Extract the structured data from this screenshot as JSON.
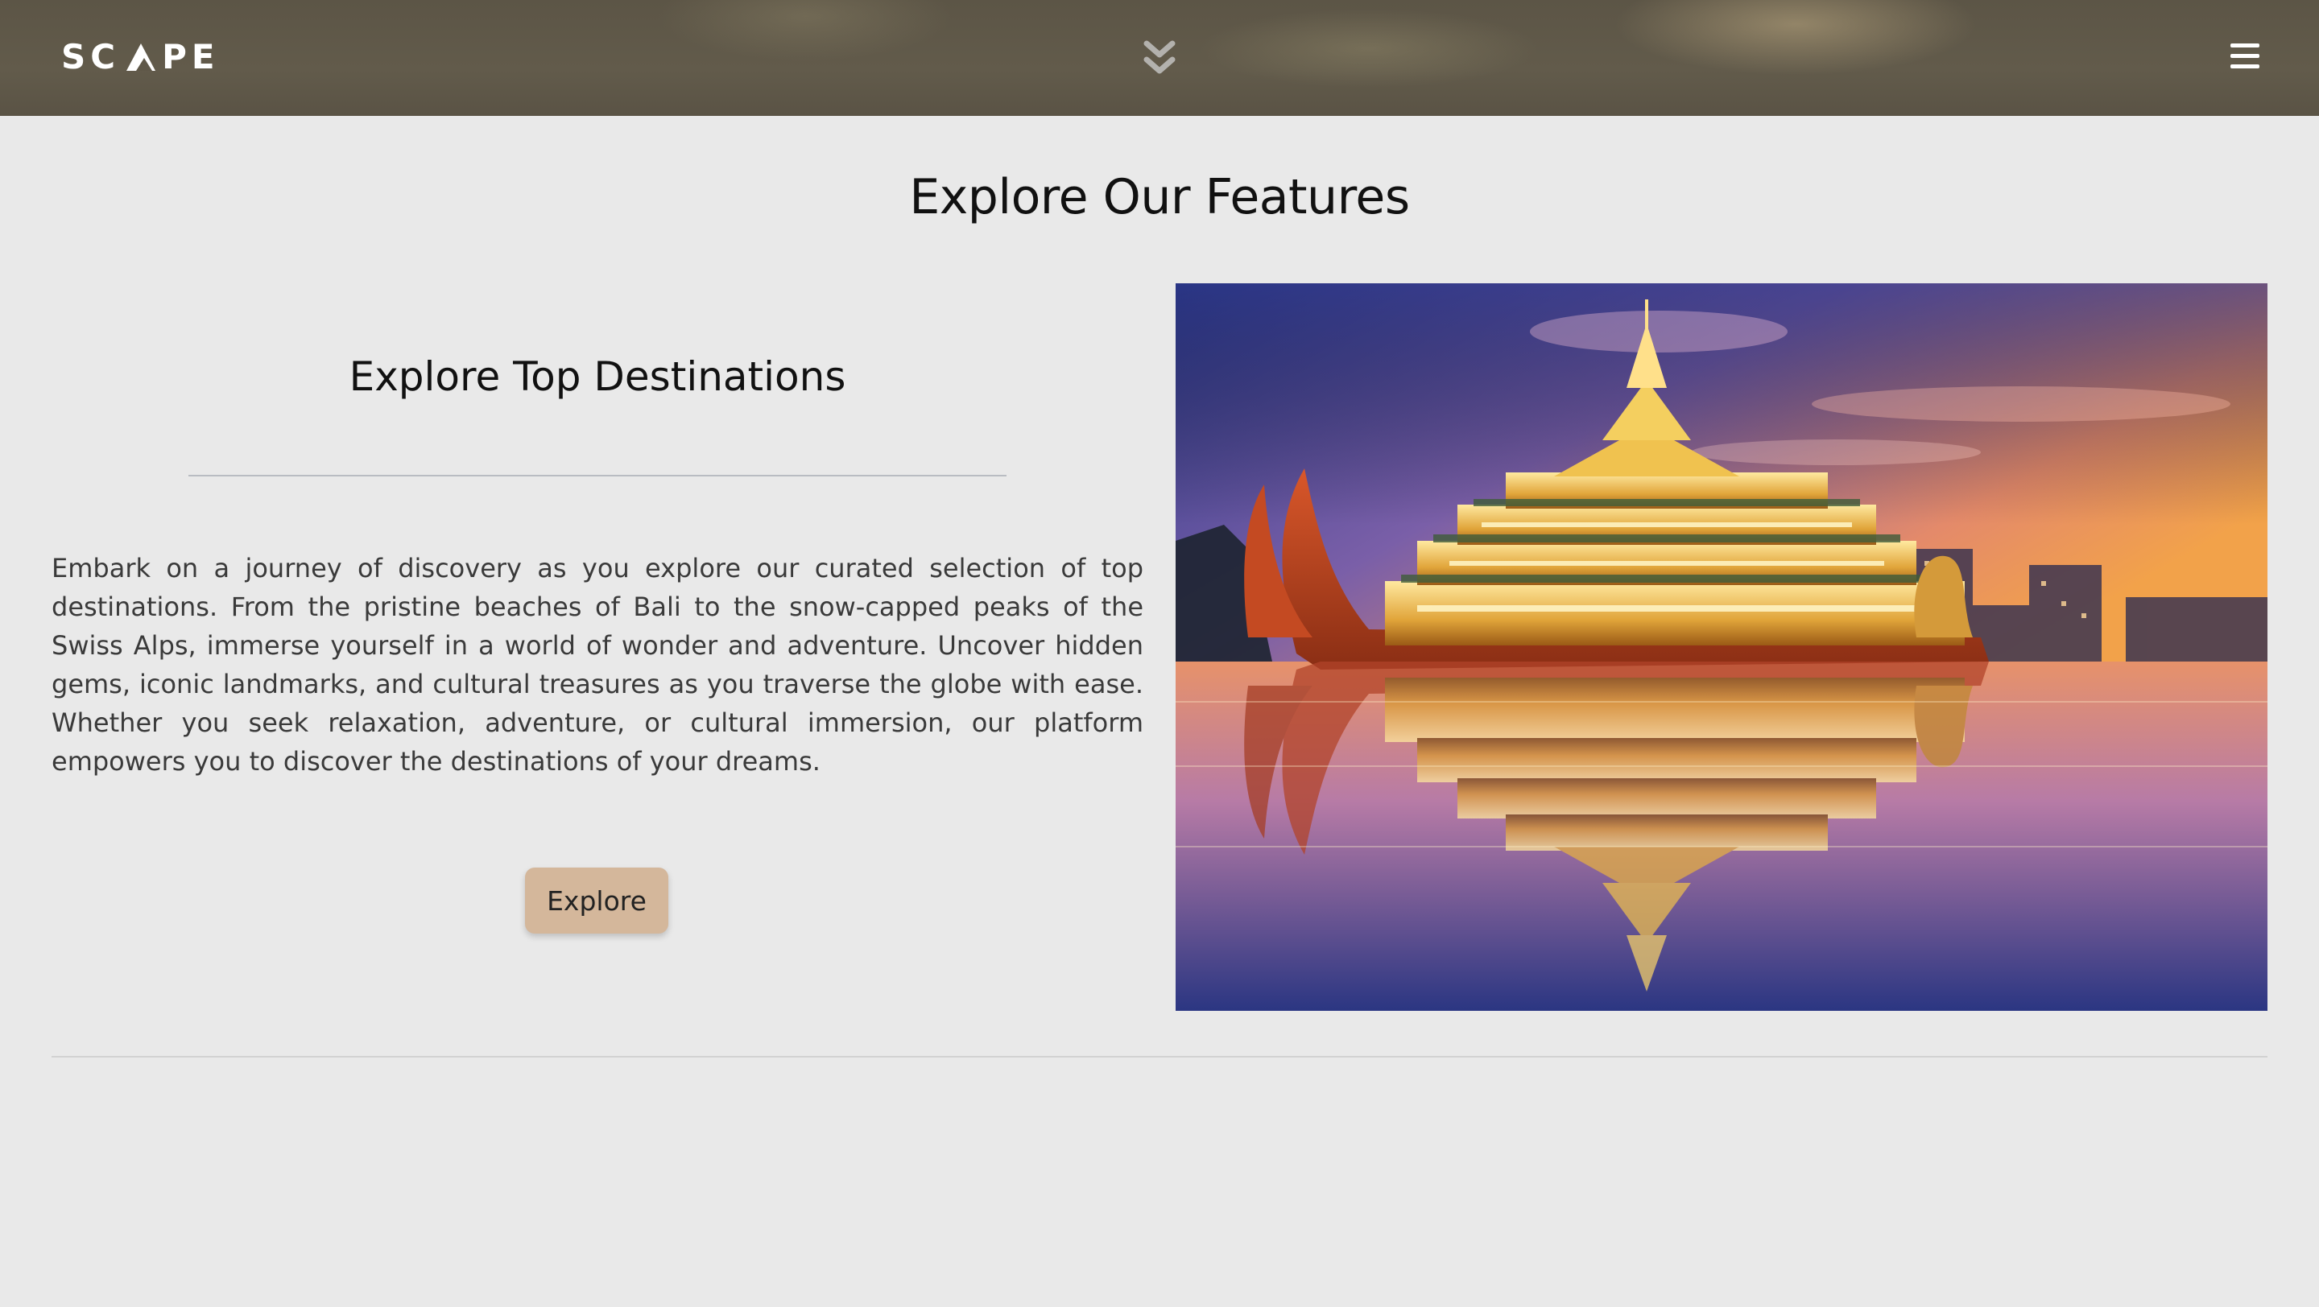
{
  "header": {
    "logo_text": "SC▲PE",
    "logo_icon": "mountain-icon",
    "scroll_icon": "chevron-double-down-icon",
    "menu_icon": "hamburger-menu-icon"
  },
  "main": {
    "section_title": "Explore Our Features",
    "feature": {
      "heading": "Explore Top Destinations",
      "body": "Embark on a journey of discovery as you explore our curated selection of top destinations. From the pristine beaches of Bali to the snow-capped peaks of the Swiss Alps, immerse yourself in a world of wonder and adventure. Uncover hidden gems, iconic landmarks, and cultural treasures as you traverse the globe with ease. Whether you seek relaxation, adventure, or cultural immersion, our platform empowers you to discover the destinations of your dreams.",
      "button_label": "Explore",
      "image_subject": "golden-barge-palace-at-sunset-photo"
    }
  },
  "colors": {
    "page_background": "#e9e9e9",
    "header_background": "#5f5848",
    "button_background": "#d4b79b",
    "divider": "#b9bcc2"
  }
}
